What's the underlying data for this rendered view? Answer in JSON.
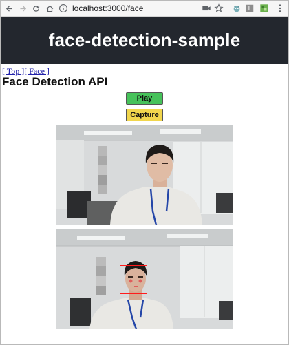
{
  "browser": {
    "url": "localhost:3000/face"
  },
  "header": {
    "title": "face-detection-sample"
  },
  "nav": {
    "links": [
      {
        "label": "[ Top ]"
      },
      {
        "label": "[ Face ]"
      }
    ]
  },
  "main": {
    "heading": "Face Detection API",
    "play_label": "Play",
    "capture_label": "Capture"
  },
  "colors": {
    "header_bg": "#23272e",
    "play_bg": "#46c25a",
    "capture_bg": "#f1d64d",
    "detection_box": "#ff1b1b",
    "link": "#2222aa"
  },
  "icons": [
    "back-arrow-icon",
    "forward-arrow-icon",
    "reload-icon",
    "home-icon",
    "info-icon",
    "camera-icon",
    "star-icon",
    "extension-icon",
    "profile-icon"
  ]
}
